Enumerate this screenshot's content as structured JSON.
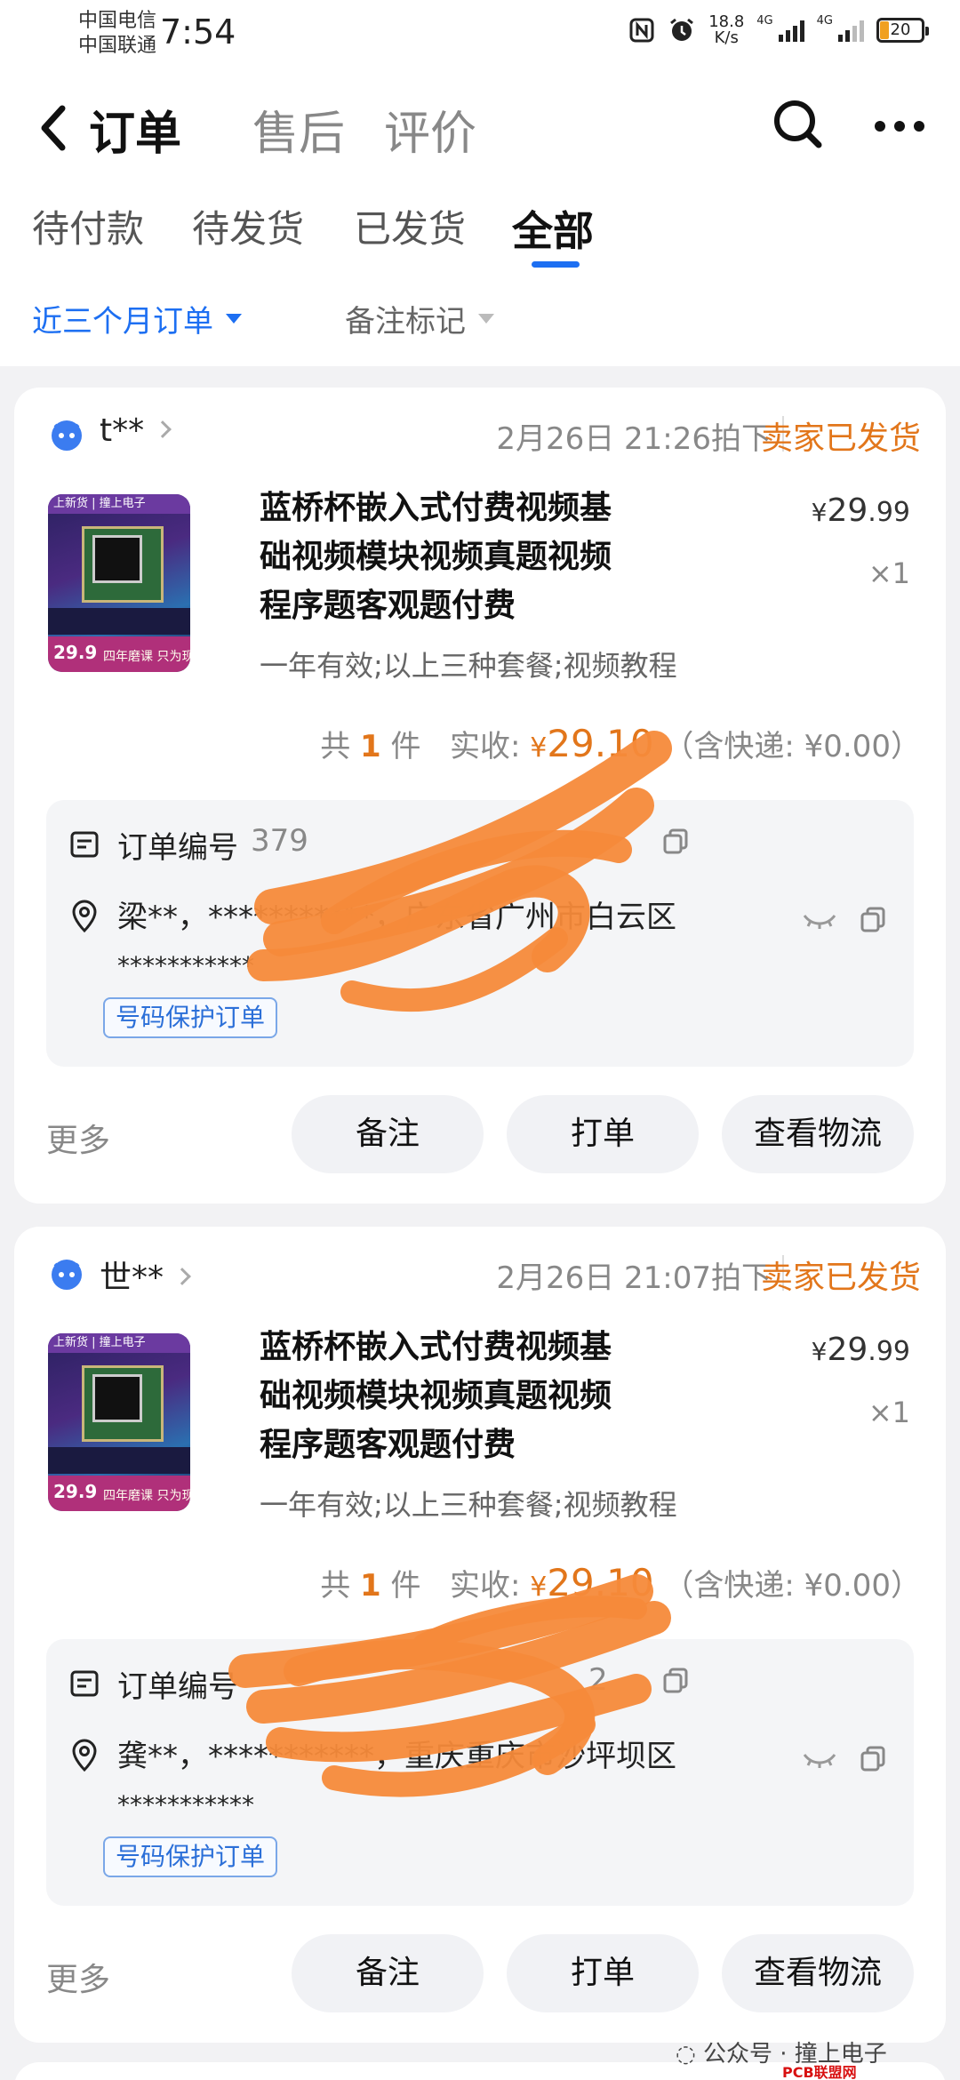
{
  "status_bar": {
    "carrier_1": "中国电信",
    "carrier_2": "中国联通",
    "time": "7:54",
    "net_speed_value": "18.8",
    "net_speed_unit": "K/s",
    "signal_1": "4G",
    "signal_2": "4G",
    "battery": "20",
    "icons": [
      "nfc-icon",
      "alarm-icon",
      "signal-icon",
      "battery-icon"
    ]
  },
  "header": {
    "top_tabs": [
      "订单",
      "售后",
      "评价"
    ],
    "sub_tabs": [
      "待付款",
      "待发货",
      "已发货",
      "全部"
    ],
    "active_sub_tab": "全部",
    "filter_range": "近三个月订单",
    "filter_note": "备注标记",
    "accent_color": "#1d6ff2"
  },
  "orders": [
    {
      "shop": "t**",
      "time": "2月26日 21:26拍下",
      "status": "卖家已发货",
      "title": "蓝桥杯嵌入式付费视频基础视频模块视频真题视频程序题客观题付费",
      "sku": "一年有效;以上三种套餐;视频教程",
      "price_symbol": "¥",
      "price_int": "29",
      "price_dec": ".99",
      "qty": "×1",
      "summary_count_prefix": "共",
      "summary_count": "1",
      "summary_count_suffix": "件",
      "summary_paid_label": "实收:",
      "summary_paid": "29.10",
      "summary_shipping": "（含快递: ¥0.00）",
      "order_no_label": "订单编号",
      "order_no": "379",
      "address": "梁**，***********，广东省广州市白云区",
      "address_detail": "***********",
      "tag": "号码保护订单",
      "more": "更多",
      "buttons": [
        "备注",
        "打单",
        "查看物流"
      ],
      "thumb_banner": "上新货 | 撞上电子",
      "thumb_price": "29.9",
      "thumb_promo": "四年磨课 只为现在"
    },
    {
      "shop": "世**",
      "time": "2月26日 21:07拍下",
      "status": "卖家已发货",
      "title": "蓝桥杯嵌入式付费视频基础视频模块视频真题视频程序题客观题付费",
      "sku": "一年有效;以上三种套餐;视频教程",
      "price_symbol": "¥",
      "price_int": "29",
      "price_dec": ".99",
      "qty": "×1",
      "summary_count_prefix": "共",
      "summary_count": "1",
      "summary_count_suffix": "件",
      "summary_paid_label": "实收:",
      "summary_paid": "29.10",
      "summary_shipping": "（含快递: ¥0.00）",
      "order_no_label": "订单编号",
      "order_no": "2",
      "address": "龚**，***********，重庆重庆市沙坪坝区",
      "address_detail": "***********",
      "tag": "号码保护订单",
      "more": "更多",
      "buttons": [
        "备注",
        "打单",
        "查看物流"
      ],
      "thumb_banner": "上新货 | 撞上电子",
      "thumb_price": "29.9",
      "thumb_promo": "四年磨课 只为现在"
    }
  ],
  "watermark": "公众号 · 撞上电子",
  "site_mark": "PCB联盟网（Pcbbar.com）",
  "colors": {
    "status_orange": "#e2761b",
    "redaction_orange": "#f58a3a"
  }
}
